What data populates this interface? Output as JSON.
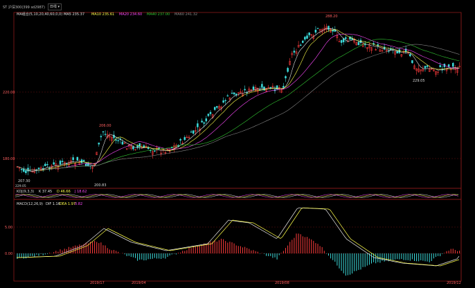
{
  "toolbar": {
    "symbol_label": "ST 沪深300(399 sd2987)",
    "period_label": "日线"
  },
  "main_panel": {
    "ma_header": {
      "title": "MA组合(5,10,20,40,60,0,0)",
      "items": [
        {
          "label": "MA5",
          "value": "235.37",
          "color": "#e6e6e6"
        },
        {
          "label": "MA10",
          "value": "235.61",
          "color": "#ffff4a"
        },
        {
          "label": "MA20",
          "value": "234.60",
          "color": "#ff4aff"
        },
        {
          "label": "MA40",
          "value": "237.00",
          "color": "#32c832"
        },
        {
          "label": "MA60",
          "value": "241.32",
          "color": "#888888"
        }
      ]
    },
    "y_labels": [
      "220.00",
      "180.00"
    ],
    "annotations": [
      "288.20",
      "206.00",
      "207.30",
      "200.83",
      "229.05"
    ],
    "bottom_left": "229.05"
  },
  "kdj_panel": {
    "title": "KDJ(9,3,3)",
    "k": "K 37.45",
    "d": "D 46.66",
    "j": "J 18.62"
  },
  "macd_panel": {
    "title": "MACD(12,26,9)",
    "dif": "DIF 1.16",
    "dea": "DEA 1.97",
    "macd": "0.82",
    "y_labels": [
      "5.00",
      "0.00"
    ]
  },
  "x_axis": {
    "labels": [
      "2019/17",
      "2019/04",
      "2019/08",
      "2019/12"
    ]
  },
  "colors": {
    "up": "#ff3c3c",
    "down": "#3cdcdc",
    "grid": "#7a1010",
    "axis": "#8b1a1a"
  }
}
